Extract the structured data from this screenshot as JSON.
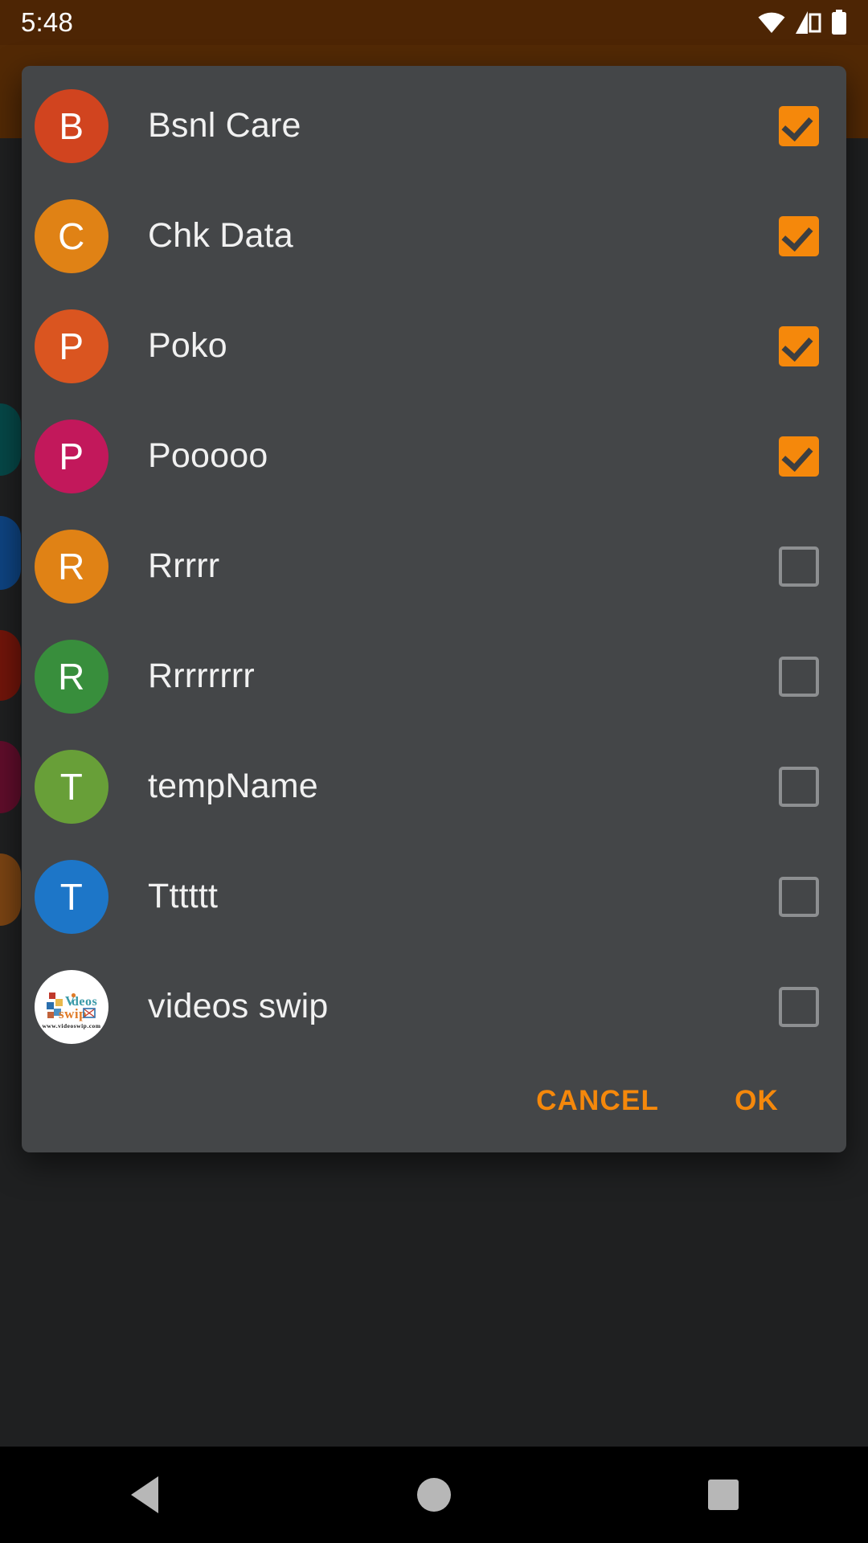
{
  "status_bar": {
    "time": "5:48",
    "icons": [
      {
        "name": "wifi-icon",
        "glyph": "wifi"
      },
      {
        "name": "cellular-signal-icon",
        "glyph": "signal"
      },
      {
        "name": "battery-icon",
        "glyph": "battery"
      }
    ]
  },
  "theme": {
    "accent": "#f5880b",
    "dialog_bg": "#444648",
    "app_bar": "#4d2504",
    "app_bar_light": "#7a3d08",
    "label_color": "#f1f1f1",
    "checkbox_border": "#8d8f91",
    "nav_bar_bg": "#000000"
  },
  "dialog": {
    "items": [
      {
        "label": "Bsnl Care",
        "initial": "B",
        "avatar_color": "#d1441f",
        "checked": true,
        "avatar_type": "initial"
      },
      {
        "label": "Chk Data",
        "initial": "C",
        "avatar_color": "#e08215",
        "checked": true,
        "avatar_type": "initial"
      },
      {
        "label": "Poko",
        "initial": "P",
        "avatar_color": "#da5520",
        "checked": true,
        "avatar_type": "initial"
      },
      {
        "label": "Pooooo",
        "initial": "P",
        "avatar_color": "#c2185b",
        "checked": true,
        "avatar_type": "initial"
      },
      {
        "label": "Rrrrr",
        "initial": "R",
        "avatar_color": "#e08215",
        "checked": false,
        "avatar_type": "initial"
      },
      {
        "label": "Rrrrrrrr",
        "initial": "R",
        "avatar_color": "#388e3c",
        "checked": false,
        "avatar_type": "initial"
      },
      {
        "label": "tempName",
        "initial": "T",
        "avatar_color": "#689f38",
        "checked": false,
        "avatar_type": "initial"
      },
      {
        "label": "Tttttt",
        "initial": "T",
        "avatar_color": "#1d76c8",
        "checked": false,
        "avatar_type": "initial"
      },
      {
        "label": "videos swip",
        "initial": "",
        "avatar_color": "#ffffff",
        "checked": false,
        "avatar_type": "logo",
        "logo": {
          "name": "videos-swip-logo",
          "line1": "Videos",
          "line2": "swip",
          "url": "www.videoswip.com"
        }
      }
    ],
    "buttons": {
      "cancel_label": "CANCEL",
      "ok_label": "OK"
    }
  },
  "nav_bar": {
    "back_label": "Back",
    "home_label": "Home",
    "recents_label": "Recents"
  }
}
